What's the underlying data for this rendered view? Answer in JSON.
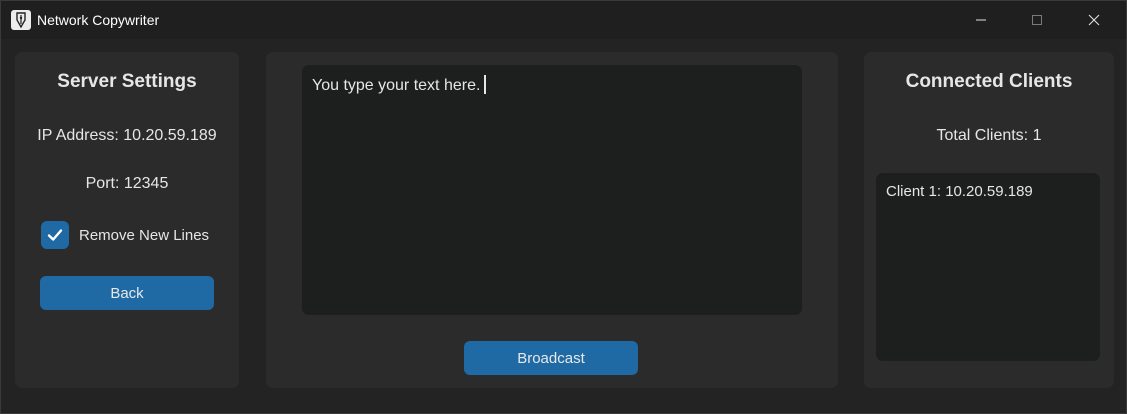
{
  "window": {
    "title": "Network Copywriter",
    "icons": {
      "app": "quill-icon",
      "minimize": "minimize-icon",
      "maximize": "maximize-icon",
      "close": "close-icon"
    }
  },
  "server_settings": {
    "heading": "Server Settings",
    "ip_line": "IP Address: 10.20.59.189",
    "port_line": "Port: 12345",
    "remove_new_lines": {
      "label": "Remove New Lines",
      "checked": true
    },
    "back_label": "Back"
  },
  "editor": {
    "text": "You type your text here.",
    "broadcast_label": "Broadcast"
  },
  "clients": {
    "heading": "Connected Clients",
    "total_line": "Total Clients: 1",
    "items": [
      {
        "label": "Client 1: 10.20.59.189"
      }
    ]
  },
  "colors": {
    "accent": "#1f6aa5",
    "panel": "#2b2b2b",
    "background": "#232323",
    "textbox": "#1d1e1e"
  }
}
